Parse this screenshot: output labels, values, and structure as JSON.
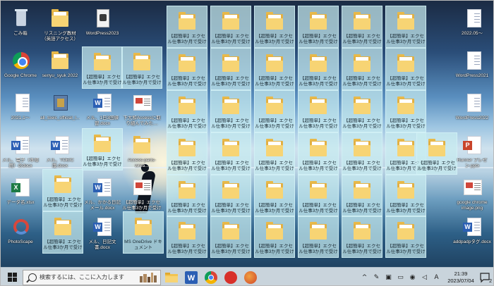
{
  "desktop": {
    "recycle_bin": "ごみ箱",
    "google_chrome": "Google Chrome",
    "file_2021": "2021.1～",
    "word_mail_short": "メル、電子（本様用）のdocx",
    "excel_file": "データ名.xlsx",
    "photoscape": "PhotoScape",
    "folder_sanshou": "リスニング教材（英語アクセス）",
    "folder_senyu": "senyu_syuk 2022",
    "winrar_file": "all_toeic_official_l...",
    "word_toeic": "メル、TOEIC版.docx",
    "folder_a": "【超簡単】エクセル仕事3か月で受ける話…",
    "folder_b": "【超簡単】エクセル仕事3か月で受ける話…",
    "folder_c": "【超簡単】エクセル仕事3か月で受ける話…",
    "wordpress_2023": "WordPress2023",
    "word_doc_mail": "メル、1日3回練習.docx",
    "access_thumb": "下大和Accessに取り組んでみた…",
    "access_parts": "Access-parts-wrea...",
    "word_another": "メル、かかる日記メール.docx",
    "pdf_doc": "メル、日記文書.docx",
    "ms_onedrive": "MS OneDrive ドキュメント",
    "right_2022": "2022.05～",
    "right_wp2021": "WordPress2021",
    "right_wp2022": "WordPress2022",
    "right_pptx": "Runner プレゼン.pptx",
    "right_png": "google chrome image.png",
    "right_docx": "addpadpタグ.docx",
    "grid_folder_label": "【超簡単】エクセル仕事3か月で受ける話…"
  },
  "taskbar": {
    "search_placeholder": "検索するには、ここに入力します",
    "time": "21:39",
    "date": "2023/07/04",
    "ime_mode": "A",
    "notification_count": "2"
  }
}
